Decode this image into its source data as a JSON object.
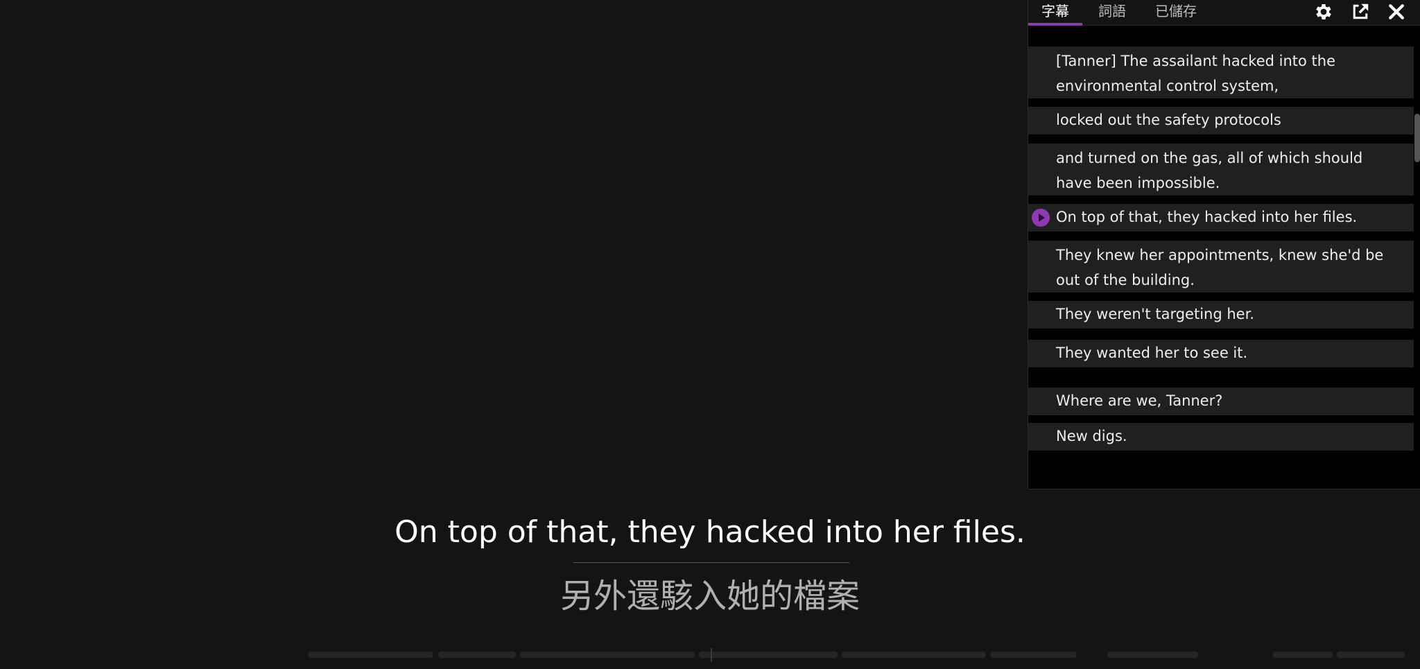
{
  "tabs": {
    "subtitles": "字幕",
    "words": "詞語",
    "saved": "已儲存"
  },
  "icons": {
    "settings": "gear-icon",
    "export": "export-icon",
    "close": "close-icon"
  },
  "colors": {
    "accent": "#8e3ab0",
    "background": "#141414",
    "row": "#202020"
  },
  "subtitle_list": [
    "[Tanner] The assailant hacked into the environmental control system,",
    "locked out the safety protocols",
    "and turned on the gas, all of which should have been impossible.",
    "On top of that, they hacked into her files.",
    "They knew her appointments, knew she'd be out of the building.",
    "They weren't targeting her.",
    "They wanted her to see it.",
    "Where are we, Tanner?",
    "New digs."
  ],
  "current_subtitle": {
    "english": "On top of that, they hacked into her files.",
    "chinese": "另外還駭入她的檔案"
  }
}
